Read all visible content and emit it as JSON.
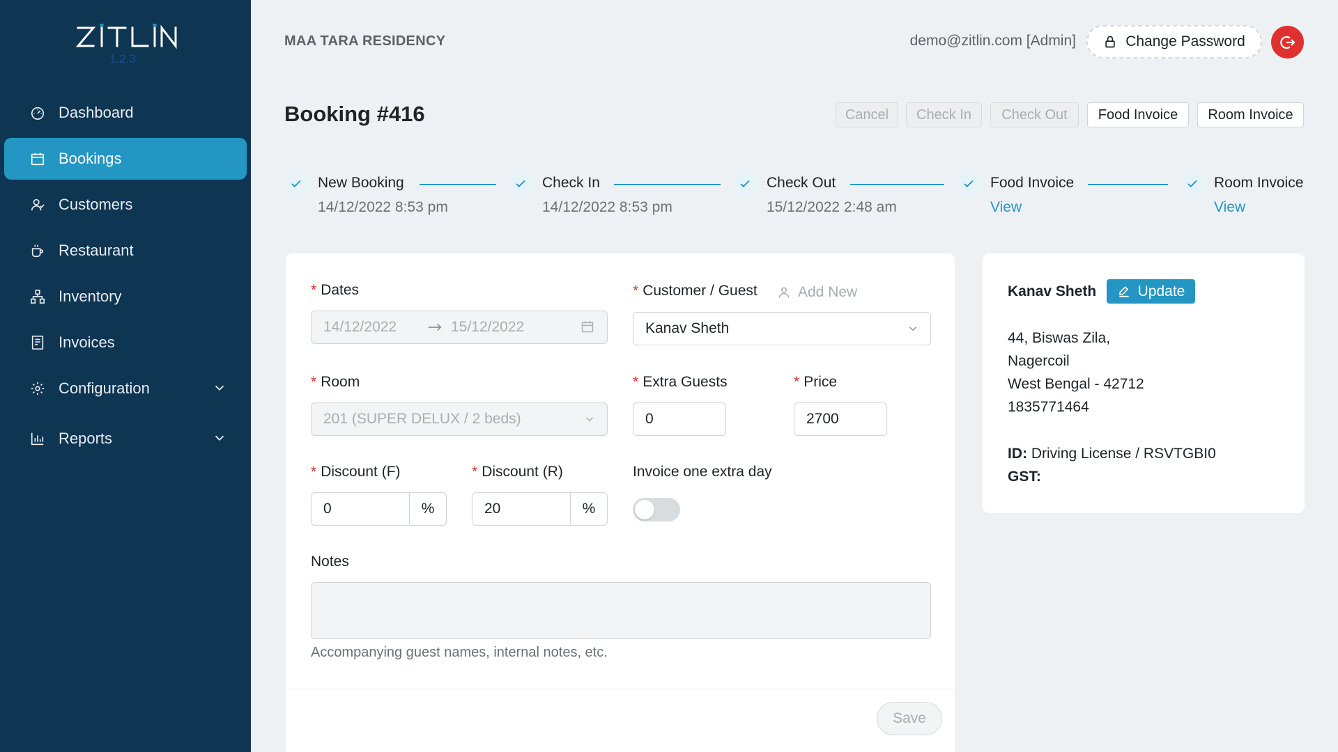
{
  "app": {
    "logo_text": "ZITLIN",
    "version": "1.2.3",
    "company": "MAA TARA RESIDENCY",
    "user_email": "demo@zitlin.com [Admin]",
    "change_password_label": "Change Password"
  },
  "sidebar": {
    "items": [
      {
        "label": "Dashboard",
        "icon": "dashboard-icon",
        "active": false
      },
      {
        "label": "Bookings",
        "icon": "calendar-icon",
        "active": true
      },
      {
        "label": "Customers",
        "icon": "customers-icon",
        "active": false
      },
      {
        "label": "Restaurant",
        "icon": "coffee-icon",
        "active": false
      },
      {
        "label": "Inventory",
        "icon": "inventory-icon",
        "active": false
      },
      {
        "label": "Invoices",
        "icon": "invoice-icon",
        "active": false
      },
      {
        "label": "Configuration",
        "icon": "gear-icon",
        "active": false
      },
      {
        "label": "Reports",
        "icon": "bar-chart-icon",
        "active": false
      }
    ]
  },
  "page": {
    "title": "Booking #416",
    "actions": {
      "cancel": "Cancel",
      "check_in": "Check In",
      "check_out": "Check Out",
      "food_invoice": "Food Invoice",
      "room_invoice": "Room Invoice"
    }
  },
  "steps": [
    {
      "title": "New Booking",
      "sub": "14/12/2022 8:53 pm"
    },
    {
      "title": "Check In",
      "sub": "14/12/2022 8:53 pm"
    },
    {
      "title": "Check Out",
      "sub": "15/12/2022 2:48 am"
    },
    {
      "title": "Food Invoice",
      "link": "View"
    },
    {
      "title": "Room Invoice",
      "link": "View"
    }
  ],
  "form": {
    "dates_label": "Dates",
    "date_start": "14/12/2022",
    "date_end": "15/12/2022",
    "customer_label": "Customer / Guest",
    "add_new": "Add New",
    "customer_value": "Kanav Sheth",
    "room_label": "Room",
    "room_value": "201 (SUPER DELUX / 2 beds)",
    "extra_guests_label": "Extra Guests",
    "extra_guests_value": "0",
    "price_label": "Price",
    "price_value": "2700",
    "discount_f_label": "Discount (F)",
    "discount_f_value": "0",
    "discount_r_label": "Discount (R)",
    "discount_r_value": "20",
    "percent": "%",
    "invoice_extra_label": "Invoice one extra day",
    "invoice_extra_on": false,
    "notes_label": "Notes",
    "notes_value": "",
    "notes_hint": "Accompanying guest names, internal notes, etc.",
    "save_label": "Save"
  },
  "customer": {
    "name": "Kanav Sheth",
    "update_label": "Update",
    "address_lines": [
      "44, Biswas Zila,",
      "Nagercoil",
      "West Bengal - 42712",
      "1835771464"
    ],
    "id_label": "ID:",
    "id_value": "Driving License / RSVTGBI0",
    "gst_label": "GST:"
  },
  "colors": {
    "sidebar_bg": "#0e3552",
    "accent": "#2496c4",
    "danger": "#e03131"
  }
}
